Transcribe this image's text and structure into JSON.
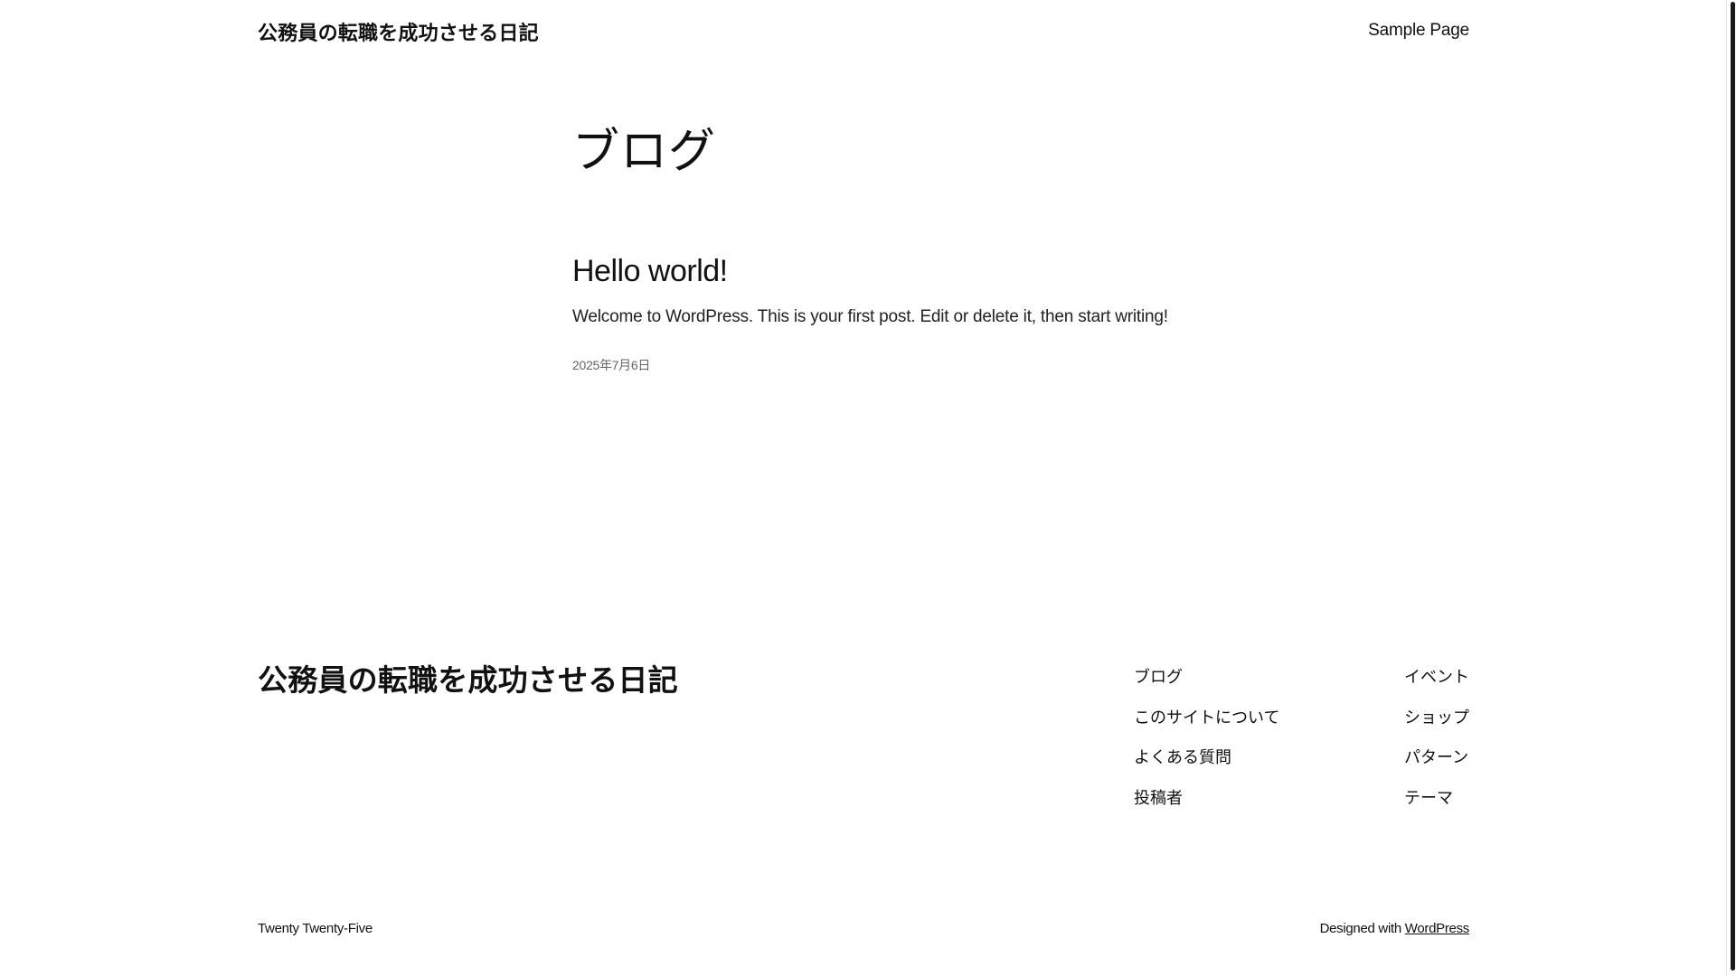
{
  "header": {
    "site_title": "公務員の転職を成功させる日記",
    "nav": {
      "sample_page": "Sample Page"
    }
  },
  "main": {
    "page_heading": "ブログ",
    "posts": [
      {
        "title": "Hello world!",
        "excerpt": "Welcome to WordPress. This is your first post. Edit or delete it, then start writing!",
        "date": "2025年7月6日"
      }
    ]
  },
  "footer": {
    "site_title": "公務員の転職を成功させる日記",
    "nav_col1": [
      "ブログ",
      "このサイトについて",
      "よくある質問",
      "投稿者"
    ],
    "nav_col2": [
      "イベント",
      "ショップ",
      "パターン",
      "テーマ"
    ],
    "theme_name": "Twenty Twenty-Five",
    "designed_with": "Designed with",
    "designed_with_link": "WordPress"
  }
}
